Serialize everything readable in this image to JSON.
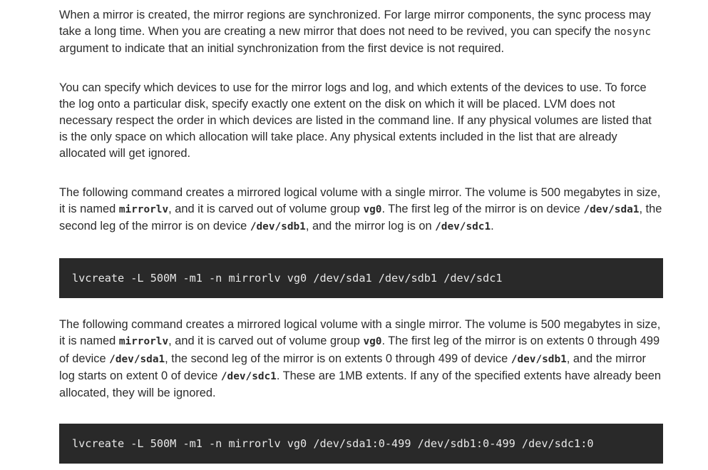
{
  "paragraphs": {
    "p1": {
      "t1": "When a mirror is created, the mirror regions are synchronized. For large mirror components, the sync process may take a long time. When you are creating a new mirror that does not need to be revived, you can specify the ",
      "c1": "nosync",
      "t2": " argument to indicate that an initial synchronization from the first device is not required."
    },
    "p2": {
      "t1": "You can specify which devices to use for the mirror logs and log, and which extents of the devices to use. To force the log onto a particular disk, specify exactly one extent on the disk on which it will be placed. LVM does not necessary respect the order in which devices are listed in the command line. If any physical volumes are listed that is the only space on which allocation will take place. Any physical extents included in the list that are already allocated will get ignored."
    },
    "p3": {
      "t1": "The following command creates a mirrored logical volume with a single mirror. The volume is 500 megabytes in size, it is named ",
      "c1": "mirrorlv",
      "t2": ", and it is carved out of volume group ",
      "c2": "vg0",
      "t3": ". The first leg of the mirror is on device ",
      "c3": "/dev/sda1",
      "t4": ", the second leg of the mirror is on device ",
      "c4": "/dev/sdb1",
      "t5": ", and the mirror log is on ",
      "c5": "/dev/sdc1",
      "t6": "."
    },
    "p4": {
      "t1": "The following command creates a mirrored logical volume with a single mirror. The volume is 500 megabytes in size, it is named ",
      "c1": "mirrorlv",
      "t2": ", and it is carved out of volume group ",
      "c2": "vg0",
      "t3": ". The first leg of the mirror is on extents 0 through 499 of device ",
      "c3": "/dev/sda1",
      "t4": ", the second leg of the mirror is on extents 0 through 499 of device ",
      "c4": "/dev/sdb1",
      "t5": ", and the mirror log starts on extent 0 of device ",
      "c5": "/dev/sdc1",
      "t6": ". These are 1MB extents. If any of the specified extents have already been allocated, they will be ignored."
    }
  },
  "code_blocks": {
    "cmd1": "lvcreate -L 500M -m1 -n mirrorlv vg0 /dev/sda1 /dev/sdb1 /dev/sdc1",
    "cmd2": "lvcreate -L 500M -m1 -n mirrorlv vg0 /dev/sda1:0-499 /dev/sdb1:0-499 /dev/sdc1:0"
  }
}
